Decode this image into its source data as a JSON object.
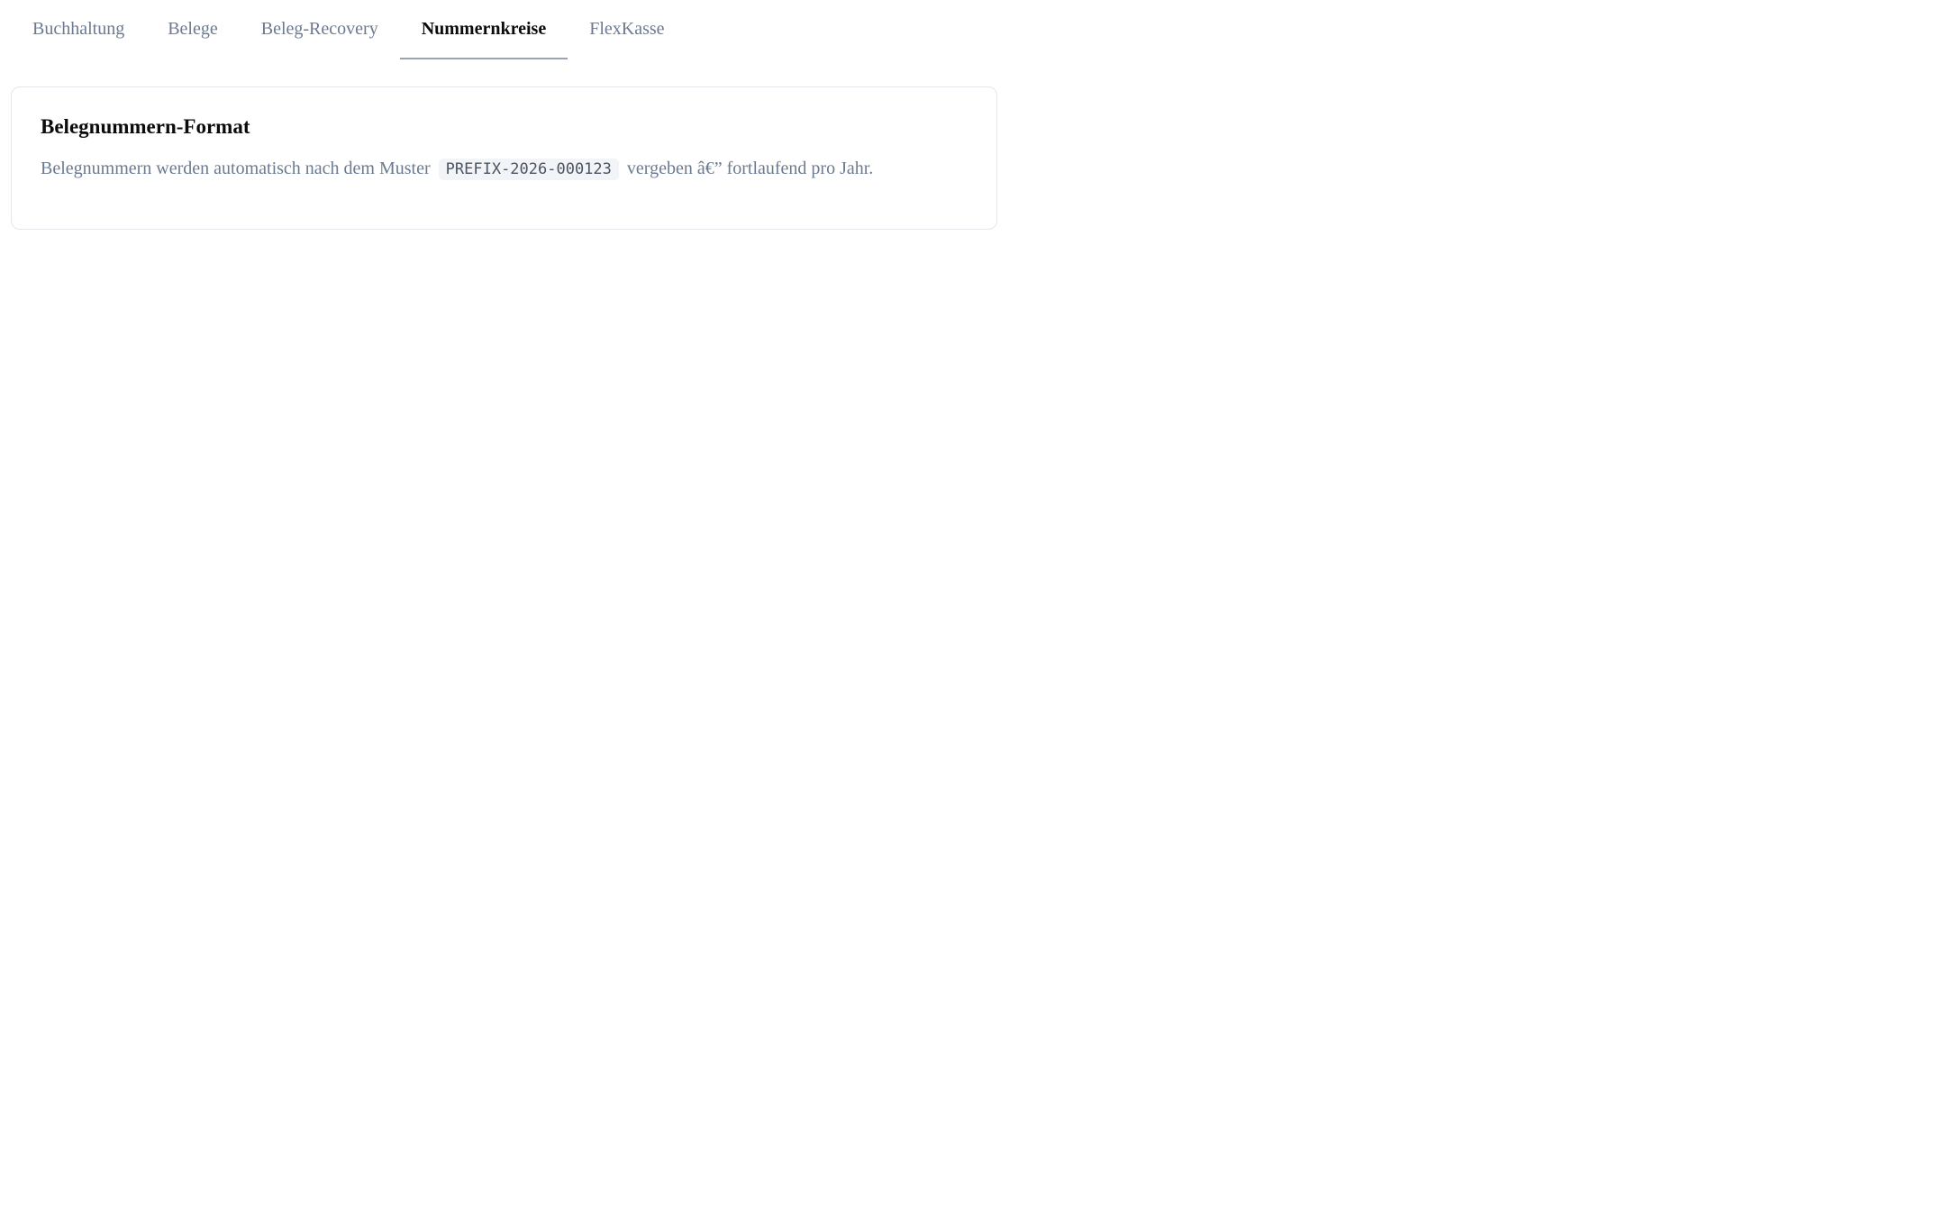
{
  "tabs": [
    {
      "label": "Buchhaltung",
      "active": false
    },
    {
      "label": "Belege",
      "active": false
    },
    {
      "label": "Beleg-Recovery",
      "active": false
    },
    {
      "label": "Nummernkreise",
      "active": true
    },
    {
      "label": "FlexKasse",
      "active": false
    }
  ],
  "card": {
    "title": "Belegnummern-Format",
    "text_before": "Belegnummern werden automatisch nach dem Muster",
    "code": "PREFIX-2026-000123",
    "text_after": "vergeben â€” fortlaufend pro Jahr."
  },
  "colors": {
    "muted_text": "#6b7a90",
    "active_tab_text": "#0b0b0b",
    "active_tab_underline": "#9aa3af",
    "card_border": "#e3e6ea",
    "code_background": "#f2f4f7"
  }
}
